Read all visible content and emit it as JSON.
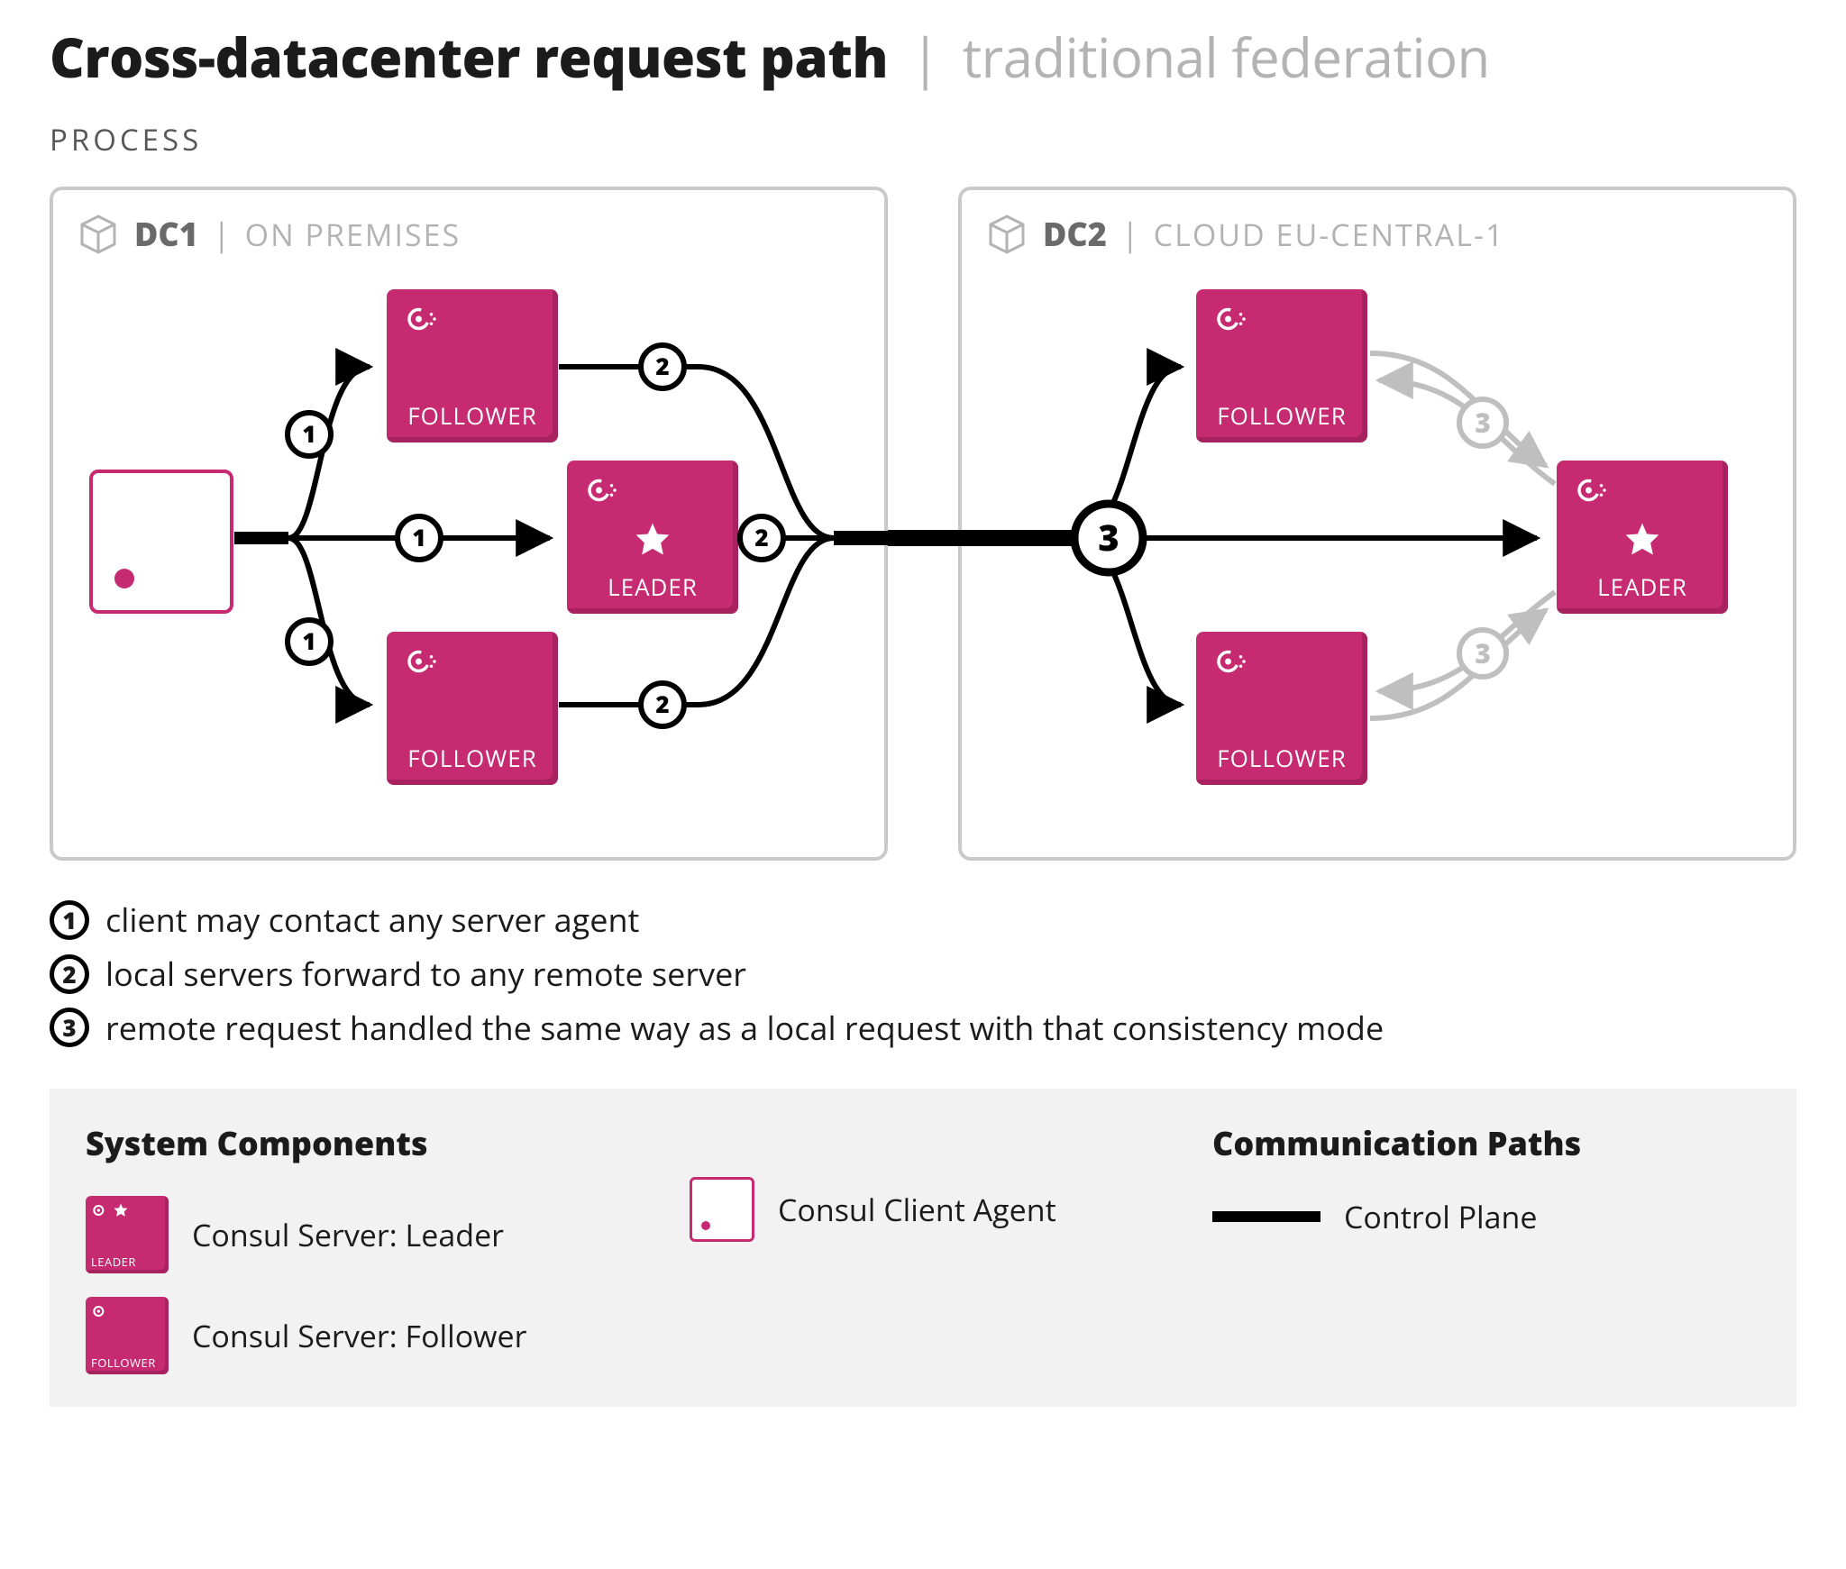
{
  "title": {
    "main": "Cross-datacenter request path",
    "sep": "|",
    "sub": "traditional federation"
  },
  "section_label": "PROCESS",
  "dc1": {
    "name": "DC1",
    "sep": "|",
    "sub": "ON PREMISES",
    "client": true,
    "servers": {
      "top": "FOLLOWER",
      "mid": "LEADER",
      "bot": "FOLLOWER"
    }
  },
  "dc2": {
    "name": "DC2",
    "sep": "|",
    "sub": "CLOUD EU-CENTRAL-1",
    "servers": {
      "top": "FOLLOWER",
      "mid": "LEADER",
      "bot": "FOLLOWER"
    }
  },
  "edge_labels": {
    "l1a": "1",
    "l1b": "1",
    "l1c": "1",
    "l2a": "2",
    "l2b": "2",
    "l2c": "2",
    "wan": "3",
    "r3a": "3",
    "r3b": "3"
  },
  "steps": [
    {
      "n": "1",
      "text": "client may contact any server agent"
    },
    {
      "n": "2",
      "text": "local servers forward to any remote server"
    },
    {
      "n": "3",
      "text": "remote request handled the same way as a local request with that consistency mode"
    }
  ],
  "legend": {
    "components_title": "System Components",
    "paths_title": "Communication Paths",
    "swatch_leader": "LEADER",
    "swatch_follower": "FOLLOWER",
    "leader_label": "Consul Server: Leader",
    "follower_label": "Consul Server: Follower",
    "client_label": "Consul Client Agent",
    "control_plane": "Control Plane"
  }
}
